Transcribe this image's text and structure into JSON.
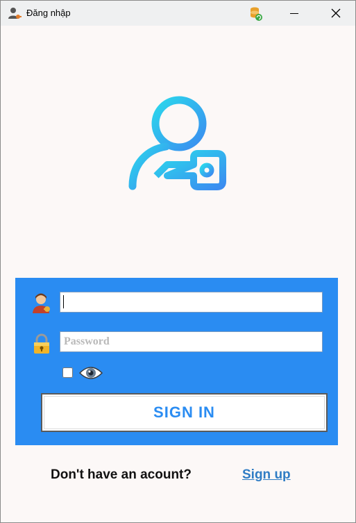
{
  "window": {
    "title": "Đăng nhập",
    "app_icon": "user-key-icon",
    "db_icon": "database-refresh-icon",
    "close_glyph": "✕"
  },
  "hero": {
    "icon": "user-key-icon",
    "gradient_from": "#2bd8ec",
    "gradient_to": "#3b8cf0"
  },
  "form": {
    "background": "#2a8cf2",
    "username": {
      "icon": "user-avatar-icon",
      "value": "",
      "placeholder": ""
    },
    "password": {
      "icon": "padlock-icon",
      "value": "",
      "placeholder": "Password"
    },
    "show_password": {
      "checked": false,
      "icon": "eye-icon"
    },
    "signin_label": "SIGN IN"
  },
  "footer": {
    "question": "Don't have an acount?",
    "signup_label": "Sign up"
  }
}
